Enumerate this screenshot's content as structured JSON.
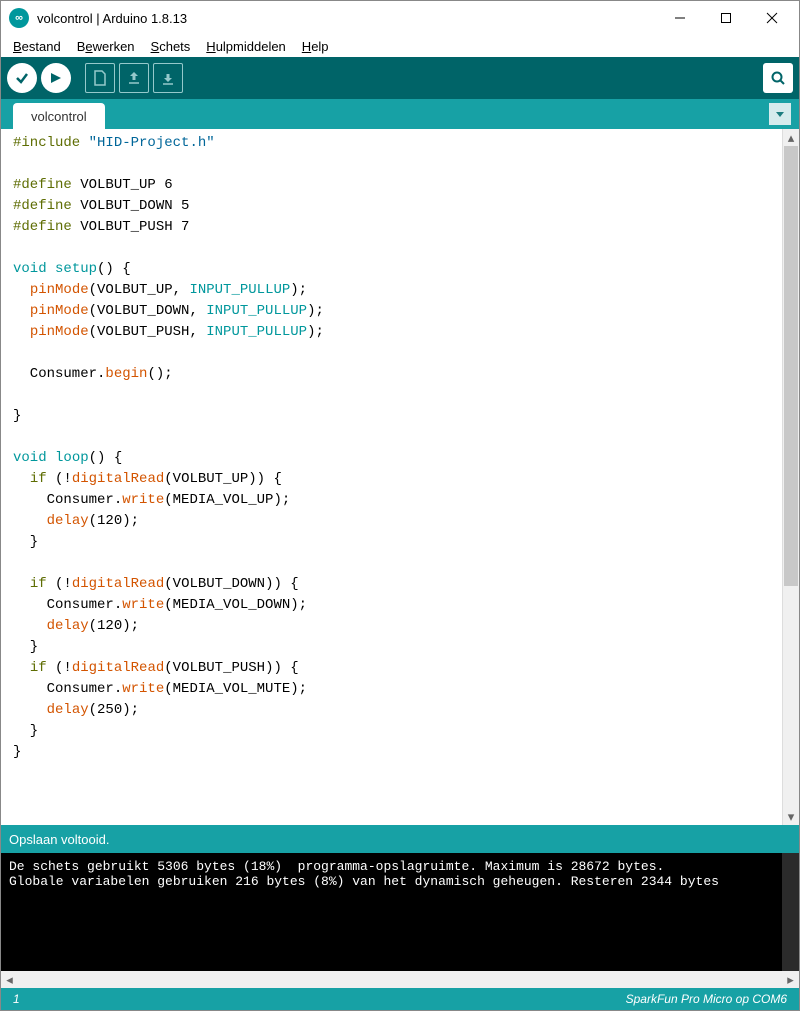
{
  "window": {
    "title": "volcontrol | Arduino 1.8.13"
  },
  "menu": {
    "items": [
      {
        "label": "Bestand",
        "accel": "B"
      },
      {
        "label": "Bewerken",
        "accel": "e"
      },
      {
        "label": "Schets",
        "accel": "S"
      },
      {
        "label": "Hulpmiddelen",
        "accel": "H"
      },
      {
        "label": "Help",
        "accel": "H"
      }
    ]
  },
  "tabs": {
    "active": "volcontrol"
  },
  "code": {
    "tokens": [
      [
        "pre",
        "#include"
      ],
      [
        "txt",
        " "
      ],
      [
        "str",
        "\"HID-Project.h\""
      ],
      [
        "nl",
        ""
      ],
      [
        "nl",
        ""
      ],
      [
        "pre",
        "#define"
      ],
      [
        "txt",
        " VOLBUT_UP 6"
      ],
      [
        "nl",
        ""
      ],
      [
        "pre",
        "#define"
      ],
      [
        "txt",
        " VOLBUT_DOWN 5"
      ],
      [
        "nl",
        ""
      ],
      [
        "pre",
        "#define"
      ],
      [
        "txt",
        " VOLBUT_PUSH 7"
      ],
      [
        "nl",
        ""
      ],
      [
        "nl",
        ""
      ],
      [
        "type",
        "void"
      ],
      [
        "txt",
        " "
      ],
      [
        "fn",
        "setup"
      ],
      [
        "txt",
        "() {"
      ],
      [
        "nl",
        ""
      ],
      [
        "txt",
        "  "
      ],
      [
        "call",
        "pinMode"
      ],
      [
        "txt",
        "(VOLBUT_UP, "
      ],
      [
        "type",
        "INPUT_PULLUP"
      ],
      [
        "txt",
        ");"
      ],
      [
        "nl",
        ""
      ],
      [
        "txt",
        "  "
      ],
      [
        "call",
        "pinMode"
      ],
      [
        "txt",
        "(VOLBUT_DOWN, "
      ],
      [
        "type",
        "INPUT_PULLUP"
      ],
      [
        "txt",
        ");"
      ],
      [
        "nl",
        ""
      ],
      [
        "txt",
        "  "
      ],
      [
        "call",
        "pinMode"
      ],
      [
        "txt",
        "(VOLBUT_PUSH, "
      ],
      [
        "type",
        "INPUT_PULLUP"
      ],
      [
        "txt",
        ");"
      ],
      [
        "nl",
        ""
      ],
      [
        "nl",
        ""
      ],
      [
        "txt",
        "  Consumer."
      ],
      [
        "call",
        "begin"
      ],
      [
        "txt",
        "();"
      ],
      [
        "nl",
        ""
      ],
      [
        "nl",
        ""
      ],
      [
        "txt",
        "}"
      ],
      [
        "nl",
        ""
      ],
      [
        "nl",
        ""
      ],
      [
        "type",
        "void"
      ],
      [
        "txt",
        " "
      ],
      [
        "fn",
        "loop"
      ],
      [
        "txt",
        "() {"
      ],
      [
        "nl",
        ""
      ],
      [
        "txt",
        "  "
      ],
      [
        "kw",
        "if"
      ],
      [
        "txt",
        " (!"
      ],
      [
        "call",
        "digitalRead"
      ],
      [
        "txt",
        "(VOLBUT_UP)) {"
      ],
      [
        "nl",
        ""
      ],
      [
        "txt",
        "    Consumer."
      ],
      [
        "call",
        "write"
      ],
      [
        "txt",
        "(MEDIA_VOL_UP);"
      ],
      [
        "nl",
        ""
      ],
      [
        "txt",
        "    "
      ],
      [
        "call",
        "delay"
      ],
      [
        "txt",
        "(120);"
      ],
      [
        "nl",
        ""
      ],
      [
        "txt",
        "  }"
      ],
      [
        "nl",
        ""
      ],
      [
        "nl",
        ""
      ],
      [
        "txt",
        "  "
      ],
      [
        "kw",
        "if"
      ],
      [
        "txt",
        " (!"
      ],
      [
        "call",
        "digitalRead"
      ],
      [
        "txt",
        "(VOLBUT_DOWN)) {"
      ],
      [
        "nl",
        ""
      ],
      [
        "txt",
        "    Consumer."
      ],
      [
        "call",
        "write"
      ],
      [
        "txt",
        "(MEDIA_VOL_DOWN);"
      ],
      [
        "nl",
        ""
      ],
      [
        "txt",
        "    "
      ],
      [
        "call",
        "delay"
      ],
      [
        "txt",
        "(120);"
      ],
      [
        "nl",
        ""
      ],
      [
        "txt",
        "  }"
      ],
      [
        "nl",
        ""
      ],
      [
        "txt",
        "  "
      ],
      [
        "kw",
        "if"
      ],
      [
        "txt",
        " (!"
      ],
      [
        "call",
        "digitalRead"
      ],
      [
        "txt",
        "(VOLBUT_PUSH)) {"
      ],
      [
        "nl",
        ""
      ],
      [
        "txt",
        "    Consumer."
      ],
      [
        "call",
        "write"
      ],
      [
        "txt",
        "(MEDIA_VOL_MUTE);"
      ],
      [
        "nl",
        ""
      ],
      [
        "txt",
        "    "
      ],
      [
        "call",
        "delay"
      ],
      [
        "txt",
        "(250);"
      ],
      [
        "nl",
        ""
      ],
      [
        "txt",
        "  }"
      ],
      [
        "nl",
        ""
      ],
      [
        "txt",
        "}"
      ],
      [
        "nl",
        ""
      ]
    ]
  },
  "status": {
    "message": "Opslaan voltooid."
  },
  "console": {
    "line1": "De schets gebruikt 5306 bytes (18%)  programma-opslagruimte. Maximum is 28672 bytes.",
    "line2": "Globale variabelen gebruiken 216 bytes (8%) van het dynamisch geheugen. Resteren 2344 bytes"
  },
  "footer": {
    "line": "1",
    "board": "SparkFun Pro Micro op COM6"
  }
}
